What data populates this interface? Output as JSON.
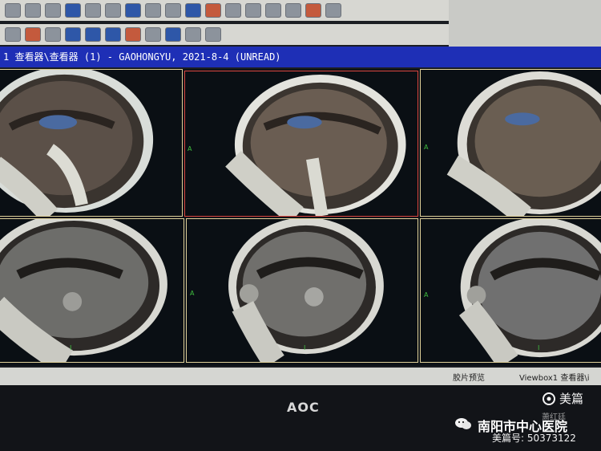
{
  "window": {
    "title": "1 查看器\\查看器 (1) - GAOHONGYU, 2021-8-4 (UNREAD)"
  },
  "status": {
    "left_text": "胶片预览",
    "right_text": "Viewbox1 查看器\\i"
  },
  "monitor": {
    "brand": "AOC"
  },
  "watermark": {
    "logo_text": "美篇",
    "small_text": "萧红廷",
    "hospital": "南阳市中心医院",
    "account": "美篇号: 50373122"
  },
  "scan_markers": {
    "anterior": "A",
    "inferior": "I"
  },
  "icons": [
    "save-icon",
    "open-icon",
    "print-icon",
    "layout-icon",
    "annotation-icon",
    "measure-icon",
    "camera-icon",
    "settings-icon",
    "layer-icon",
    "window-icon"
  ]
}
